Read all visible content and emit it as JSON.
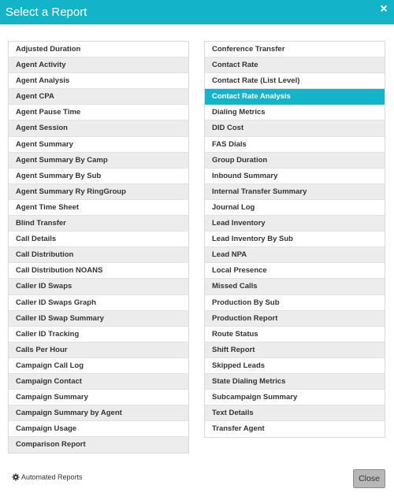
{
  "modal": {
    "title": "Select a Report",
    "close_symbol": "×"
  },
  "left_reports": [
    "Adjusted Duration",
    "Agent Activity",
    "Agent Analysis",
    "Agent CPA",
    "Agent Pause Time",
    "Agent Session",
    "Agent Summary",
    "Agent Summary By Camp",
    "Agent Summary By Sub",
    "Agent Summary Ry RingGroup",
    "Agent Time Sheet",
    "Blind Transfer",
    "Call Details",
    "Call Distribution",
    "Call Distribution NOANS",
    "Caller ID Swaps",
    "Caller ID Swaps Graph",
    "Caller ID Swap Summary",
    "Caller ID Tracking",
    "Calls Per Hour",
    "Campaign Call Log",
    "Campaign Contact",
    "Campaign Summary",
    "Campaign Summary by Agent",
    "Campaign Usage",
    "Comparison Report"
  ],
  "right_reports": [
    "Conference Transfer",
    "Contact Rate",
    "Contact Rate (List Level)",
    "Contact Rate Analysis",
    "Dialing Metrics",
    "DID Cost",
    "FAS Dials",
    "Group Duration",
    "Inbound Summary",
    "Internal Transfer Summary",
    "Journal Log",
    "Lead Inventory",
    "Lead Inventory By Sub",
    "Lead NPA",
    "Local Presence",
    "Missed Calls",
    "Production By Sub",
    "Production Report",
    "Route Status",
    "Shift Report",
    "Skipped Leads",
    "State Dialing Metrics",
    "Subcampaign Summary",
    "Text Details",
    "Transfer Agent"
  ],
  "selected_report": "Contact Rate Analysis",
  "footer": {
    "automated_label": "Automated Reports",
    "automated_icon": "gear-icon",
    "close_label": "Close"
  },
  "colors": {
    "accent": "#14b4c8",
    "stripe": "#ececec"
  }
}
